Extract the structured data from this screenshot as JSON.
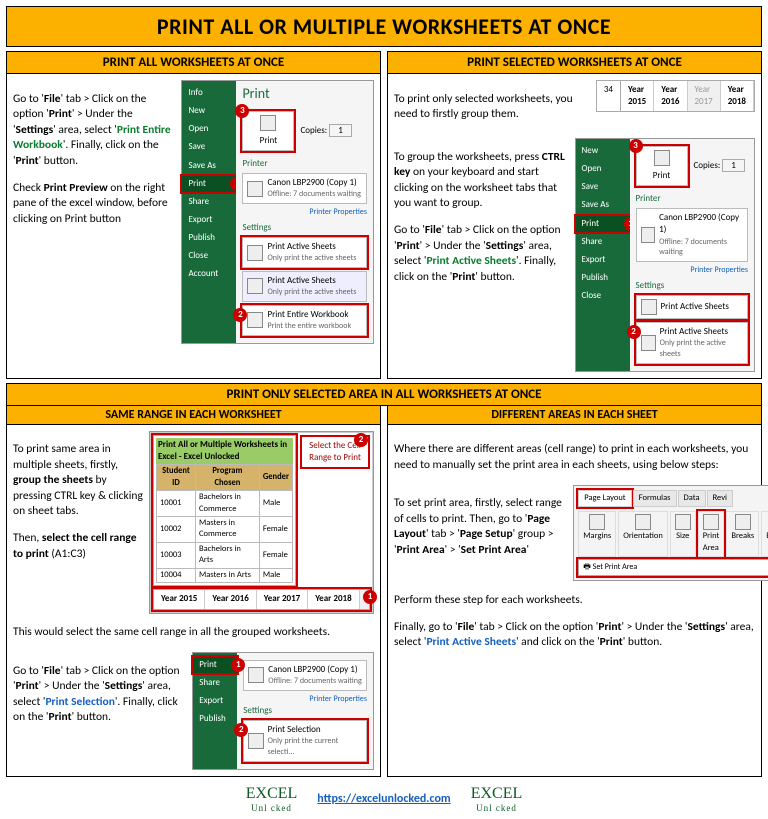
{
  "title": "PRINT ALL OR MULTIPLE WORKSHEETS AT ONCE",
  "s1": {
    "title": "PRINT ALL WORKSHEETS AT ONCE",
    "p1a": "Go to '",
    "p1b": "' tab > Click on the option '",
    "p1c": "' > Under the '",
    "p1d": "' area, select '",
    "p1e": "'. Finally, click on the '",
    "p1f": "' button.",
    "file": "File",
    "print": "Print",
    "settings": "Settings",
    "option": "Print Entire Workbook",
    "btn": "Print",
    "p2a": "Check ",
    "preview": "Print Preview",
    "p2b": " on the right pane of the excel window, before clicking on Print button"
  },
  "s2": {
    "title": "PRINT SELECTED WORKSHEETS AT ONCE",
    "p1": "To print only selected worksheets, you need to firstly group them.",
    "p2a": "To group the worksheets, press ",
    "ctrl": "CTRL key",
    "p2b": " on your keyboard and start clicking on the worksheet tabs that you want to group.",
    "p3a": "Go to '",
    "file": "File",
    "p3b": "' tab > Click on the option '",
    "print": "Print",
    "p3c": "' > Under the '",
    "settings": "Settings",
    "p3d": "' area, select '",
    "option": "Print Active Sheets",
    "p3e": "'. Finally, click on the '",
    "btn": "Print",
    "p3f": "' button."
  },
  "s3title": "PRINT ONLY SELECTED AREA IN ALL WORKSHEETS AT ONCE",
  "s3a": {
    "title": "SAME RANGE IN EACH WORKSHEET",
    "p1a": "To print same area in multiple sheets, firstly, ",
    "group": "group the sheets",
    "p1b": " by pressing CTRL key & clicking on sheet tabs.",
    "p2a": "Then, ",
    "sel": "select the cell range to print",
    "p2b": " (A1:C3)",
    "p3": "This would select the same cell range in all the grouped worksheets.",
    "p4a": "Go to '",
    "file": "File",
    "p4b": "' tab > Click on the option '",
    "print": "Print",
    "p4c": "' > Under the '",
    "settings": "Settings",
    "p4d": "' area, select '",
    "option": "Print Selection",
    "p4e": "'. Finally, click on the '",
    "btn": "Print",
    "p4f": "' button."
  },
  "s3b": {
    "title": "DIFFERENT AREAS IN EACH SHEET",
    "p1": "Where there are different areas (cell range) to print in each worksheets, you need to manually set the print area in each sheets, using below steps:",
    "p2a": "To set print area, firstly, select range of cells to print. Then, go to '",
    "pl": "Page Layout",
    "p2b": "' tab > '",
    "ps": "Page Setup",
    "p2c": "' group > '",
    "pa": "Print Area",
    "p2d": "' > '",
    "spa": "Set Print Area",
    "p2e": "'",
    "p3": "Perform these step for each worksheets.",
    "p4a": "Finally, go to '",
    "file": "File",
    "p4b": "' tab > Click on the option '",
    "print": "Print",
    "p4c": "' > Under the '",
    "settings": "Settings",
    "p4d": "' area, select '",
    "option": "Print Active Sheets",
    "p4e": "' and click on the '",
    "btn": "Print",
    "p4f": "' button."
  },
  "shot": {
    "menu": [
      "Info",
      "New",
      "Open",
      "Save",
      "Save As",
      "Print",
      "Share",
      "Export",
      "Publish",
      "Close",
      "Account"
    ],
    "printHead": "Print",
    "copies": "Copies:",
    "copiesVal": "1",
    "printerHead": "Printer",
    "printerName": "Canon LBP2900 (Copy 1)",
    "printerStatus": "Offline: 7 documents waiting",
    "printerProps": "Printer Properties",
    "settingsHead": "Settings",
    "optActive": "Print Active Sheets",
    "optActiveSub": "Only print the active sheets",
    "optEntire": "Print Entire Workbook",
    "optEntireSub": "Print the entire workbook",
    "optSel": "Print Selection",
    "optSelSub": "Only print the current selecti..."
  },
  "tabs": {
    "cell": "34",
    "t1": "Year 2015",
    "t2": "Year 2016",
    "t3": "Year 2017",
    "t4": "Year 2018"
  },
  "tbl": {
    "title": "Print All or Multiple Worksheets in Excel - Excel Unlocked",
    "h1": "Student ID",
    "h2": "Program Chosen",
    "h3": "Gender",
    "r1c1": "10001",
    "r1c2": "Bachelors in Commerce",
    "r1c3": "Male",
    "r2c1": "10002",
    "r2c2": "Masters in Commerce",
    "r2c3": "Female",
    "r3c1": "10003",
    "r3c2": "Bachelors in Arts",
    "r3c3": "Female",
    "r4c1": "10004",
    "r4c2": "Masters in Arts",
    "r4c3": "Male",
    "callout": "Select the Cell Range to Print"
  },
  "ribbon": {
    "t1": "Page Layout",
    "t2": "Formulas",
    "t3": "Data",
    "t4": "Revi",
    "g1": "Margins",
    "g2": "Orientation",
    "g3": "Size",
    "g4": "Print Area",
    "g5": "Breaks",
    "g6": "Background",
    "dd": "Set Print Area"
  },
  "footer": {
    "brand": "EXCEL",
    "brandSub": "Unl   cked",
    "url": "https://excelunlocked.com"
  }
}
